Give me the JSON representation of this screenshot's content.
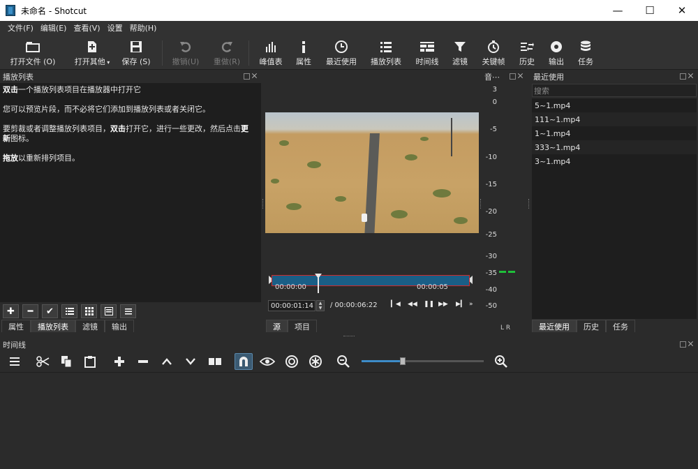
{
  "window": {
    "title": "未命名 - Shotcut",
    "minimize": "—",
    "maximize": "☐",
    "close": "✕"
  },
  "menu": [
    "文件(F)",
    "编辑(E)",
    "查看(V)",
    "设置",
    "帮助(H)"
  ],
  "toolbar": {
    "open_file": "打开文件 (O)",
    "open_other": "打开其他",
    "save": "保存 (S)",
    "undo": "撤销(U)",
    "redo": "重做(R)",
    "peak": "峰值表",
    "properties": "属性",
    "recent": "最近使用",
    "playlist": "播放列表",
    "timeline": "时间线",
    "filters": "滤镜",
    "keyframes": "关键帧",
    "history": "历史",
    "export": "输出",
    "jobs": "任务"
  },
  "playlist": {
    "title": "播放列表",
    "line1_bold": "双击",
    "line1": "一个播放列表项目在播放器中打开它",
    "line2": "您可以预览片段，而不必将它们添加到播放列表或者关闭它。",
    "line3a": "要剪裁或者调整播放列表项目，",
    "line3_bold": "双击",
    "line3b": "打开它，进行一些更改，然后点击",
    "line3_bold2a": "更",
    "line3_bold2b": "新",
    "line3c": "图标。",
    "line4_bold": "拖放",
    "line4": "以重新排列项目。",
    "tabs": [
      "属性",
      "播放列表",
      "滤镜",
      "输出"
    ]
  },
  "player": {
    "scrub_start": "00:00:00",
    "scrub_mid": "00:00:05",
    "position": "00:00:01:14",
    "duration": "/ 00:00:06:22",
    "tabs": [
      "源",
      "项目"
    ]
  },
  "meter": {
    "title": "音⋯",
    "labels": [
      "3",
      "0",
      "-5",
      "-10",
      "-15",
      "-20",
      "-25",
      "-30",
      "-35",
      "-40",
      "-50"
    ],
    "channels": "L  R",
    "level_db": -35
  },
  "recent": {
    "title": "最近使用",
    "search_placeholder": "搜索",
    "items": [
      "5~1.mp4",
      "111~1.mp4",
      "1~1.mp4",
      "333~1.mp4",
      "3~1.mp4"
    ],
    "tabs": [
      "最近使用",
      "历史",
      "任务"
    ]
  },
  "timeline": {
    "title": "时间线",
    "zoom_level": 0.35
  },
  "colors": {
    "accent": "#3d8cc8",
    "scrub_fill": "#1a5e86",
    "in_out": "#d02a2a",
    "meter_green": "#1fbf3a"
  }
}
